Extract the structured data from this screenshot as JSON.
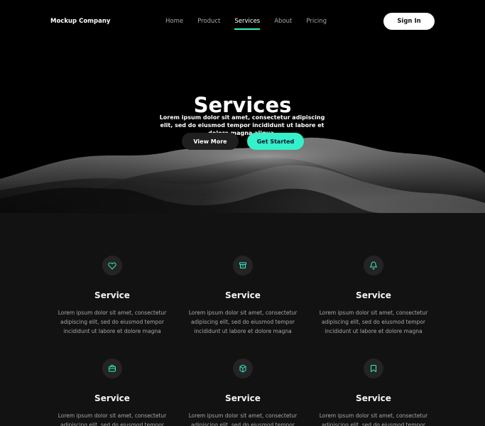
{
  "header": {
    "brand": "Mockup Company",
    "nav": [
      "Home",
      "Product",
      "Services",
      "About",
      "Pricing"
    ],
    "active_nav": "Services",
    "sign_in": "Sign In"
  },
  "hero": {
    "title": "Services",
    "subtitle": "Lorem ipsum dolor sit amet, consectetur adipiscing elit, sed do eiusmod tempor incididunt ut labore et dolore magna aliqua.",
    "view_more": "View More",
    "get_started": "Get Started"
  },
  "colors": {
    "accent": "#35f0c8",
    "background": "#121212",
    "hero_background": "#000000"
  },
  "services": {
    "cards": [
      {
        "icon": "heart-icon",
        "title": "Service",
        "text": "Lorem ipsum dolor sit amet, consectetur adipiscing elit, sed do eiusmod tempor incididunt ut labore et dolore magna"
      },
      {
        "icon": "archive-icon",
        "title": "Service",
        "text": "Lorem ipsum dolor sit amet, consectetur adipiscing elit, sed do eiusmod tempor incididunt ut labore et dolore magna"
      },
      {
        "icon": "bell-icon",
        "title": "Service",
        "text": "Lorem ipsum dolor sit amet, consectetur adipiscing elit, sed do eiusmod tempor incididunt ut labore et dolore magna"
      },
      {
        "icon": "briefcase-icon",
        "title": "Service",
        "text": "Lorem ipsum dolor sit amet, consectetur adipiscing elit, sed do eiusmod tempor incididunt ut labore et dolore magna"
      },
      {
        "icon": "cube-icon",
        "title": "Service",
        "text": "Lorem ipsum dolor sit amet, consectetur adipiscing elit, sed do eiusmod tempor incididunt ut labore et dolore magna"
      },
      {
        "icon": "bookmark-icon",
        "title": "Service",
        "text": "Lorem ipsum dolor sit amet, consectetur adipiscing elit, sed do eiusmod tempor incididunt ut labore et dolore magna"
      }
    ]
  }
}
